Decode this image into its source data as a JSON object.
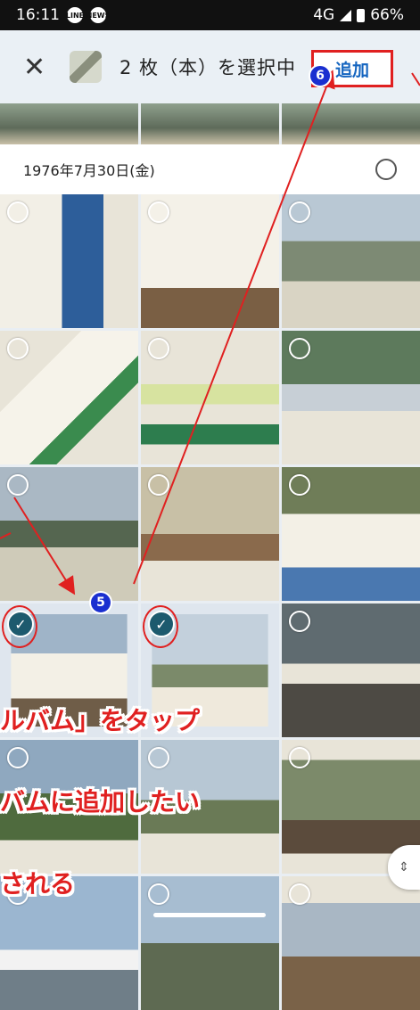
{
  "status_bar": {
    "time": "16:11",
    "network": "4G",
    "battery": "66%",
    "notif_icons": [
      "line-icon",
      "news-icon"
    ]
  },
  "app_bar": {
    "close_icon": "close-icon",
    "title": "2 枚（本）を選択中",
    "add_label": "追加"
  },
  "date_header": {
    "label": "1976年7月30日(金)"
  },
  "annotations": {
    "badge_5": "5",
    "badge_6": "6",
    "overlay_1": "ルバム」をタップ",
    "overlay_2": "バムに追加したい",
    "overlay_3": "される"
  },
  "grid": {
    "selected_positions": [
      10,
      11
    ],
    "total_visible": 21
  },
  "colors": {
    "accent_blue": "#1565c0",
    "annotation_red": "#e02020",
    "check_teal": "#1d5a6e",
    "badge_blue": "#1a2fd0"
  }
}
